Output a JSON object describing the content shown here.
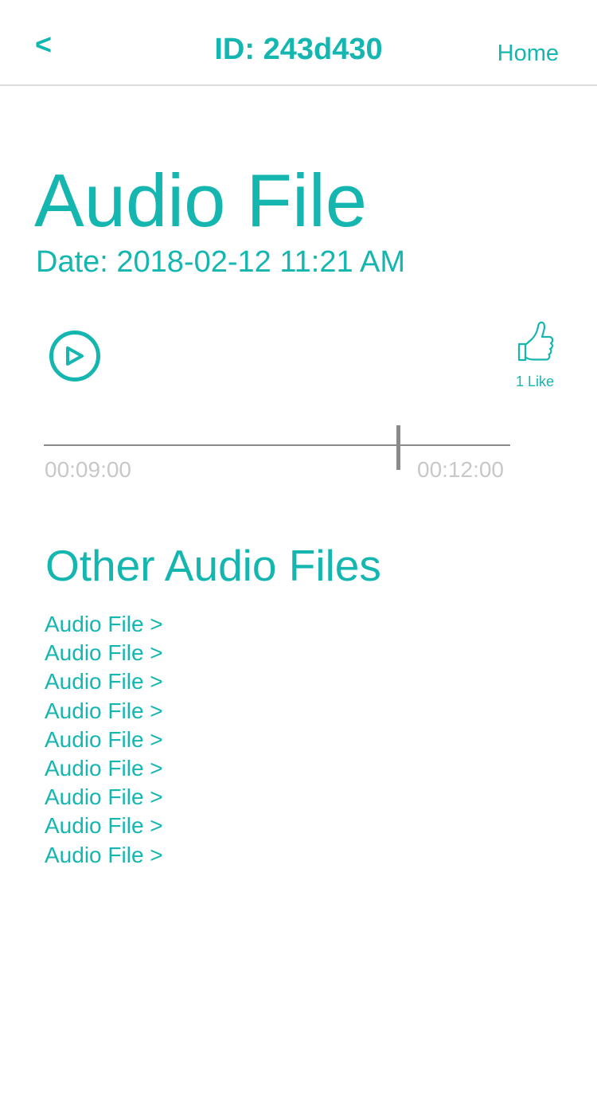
{
  "colors": {
    "accent": "#16b6b0",
    "divider": "#dcdcdc",
    "muted_text": "#c8c8c8",
    "scrubber": "#8a8a8a"
  },
  "header": {
    "back_label": "<",
    "title": "ID: 243d430",
    "home_label": "Home"
  },
  "file": {
    "title": "Audio File",
    "date": "Date: 2018-02-12 11:21 AM"
  },
  "player": {
    "play_icon": "play-circle-icon",
    "like_icon": "thumbs-up-icon",
    "like_count": "1 Like",
    "elapsed": "00:09:00",
    "total": "00:12:00",
    "progress_fraction": 0.76
  },
  "other_files": {
    "heading": "Other Audio Files",
    "items": [
      "Audio File >",
      "Audio File >",
      "Audio File >",
      "Audio File >",
      "Audio File >",
      "Audio File >",
      "Audio File >",
      "Audio File >",
      "Audio File >"
    ]
  }
}
